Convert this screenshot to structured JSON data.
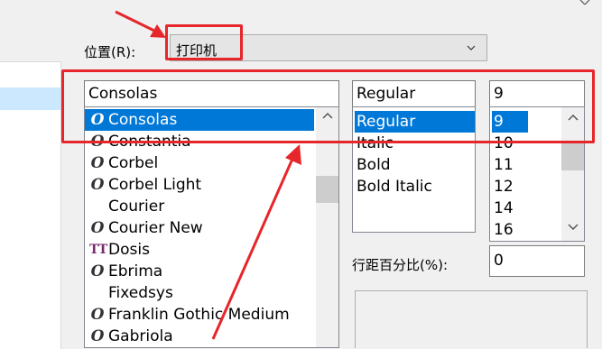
{
  "location": {
    "label": "位置(R):",
    "value": "打印机"
  },
  "font": {
    "input": "Consolas",
    "items": [
      {
        "name": "Consolas",
        "icon": "opentype-icon",
        "selected": true
      },
      {
        "name": "Constantia",
        "icon": "opentype-icon"
      },
      {
        "name": "Corbel",
        "icon": "opentype-icon"
      },
      {
        "name": "Corbel Light",
        "icon": "opentype-icon"
      },
      {
        "name": "Courier",
        "icon": ""
      },
      {
        "name": "Courier New",
        "icon": "opentype-icon"
      },
      {
        "name": "Dosis",
        "icon": "truetype-icon"
      },
      {
        "name": "Ebrima",
        "icon": "opentype-icon"
      },
      {
        "name": "Fixedsys",
        "icon": ""
      },
      {
        "name": "Franklin Gothic Medium",
        "icon": "opentype-icon"
      },
      {
        "name": "Gabriola",
        "icon": "opentype-icon"
      }
    ]
  },
  "style": {
    "input": "Regular",
    "items": [
      "Regular",
      "Italic",
      "Bold",
      "Bold Italic"
    ]
  },
  "size": {
    "input": "9",
    "items": [
      "9",
      "10",
      "11",
      "12",
      "14",
      "16"
    ]
  },
  "line_spacing": {
    "label": "行距百分比(%):",
    "value": "0"
  },
  "colors": {
    "annotation": "#e6262b",
    "selection": "#0078d7"
  }
}
